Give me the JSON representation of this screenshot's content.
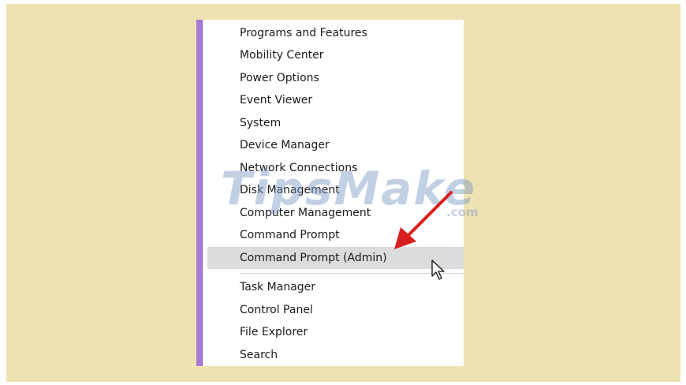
{
  "menu": {
    "items": [
      {
        "label": "Programs and Features"
      },
      {
        "label": "Mobility Center"
      },
      {
        "label": "Power Options"
      },
      {
        "label": "Event Viewer"
      },
      {
        "label": "System"
      },
      {
        "label": "Device Manager"
      },
      {
        "label": "Network Connections"
      },
      {
        "label": "Disk Management"
      },
      {
        "label": "Computer Management"
      },
      {
        "label": "Command Prompt"
      },
      {
        "label": "Command Prompt (Admin)"
      },
      {
        "label": "Task Manager"
      },
      {
        "label": "Control Panel"
      },
      {
        "label": "File Explorer"
      },
      {
        "label": "Search"
      }
    ]
  },
  "watermark": {
    "text": "TipsMake",
    "suffix": ".com"
  },
  "colors": {
    "background": "#efe2b2",
    "accent_bar": "#a87ad6",
    "highlight": "#dcdcdc",
    "arrow": "#d81f1f"
  },
  "icons": {
    "arrow": "red-arrow-icon",
    "cursor": "mouse-pointer-icon"
  }
}
